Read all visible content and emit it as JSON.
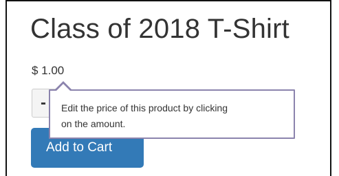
{
  "product": {
    "title": "Class of 2018 T-Shirt",
    "price": "$ 1.00"
  },
  "quantity": {
    "minus_label": "-"
  },
  "cart": {
    "add_label": "Add to Cart",
    "button_color": "#337ab7"
  },
  "tooltip": {
    "line1": "Edit the price of this product by clicking",
    "line2": "on the amount.",
    "border_color": "#8b83ad"
  }
}
